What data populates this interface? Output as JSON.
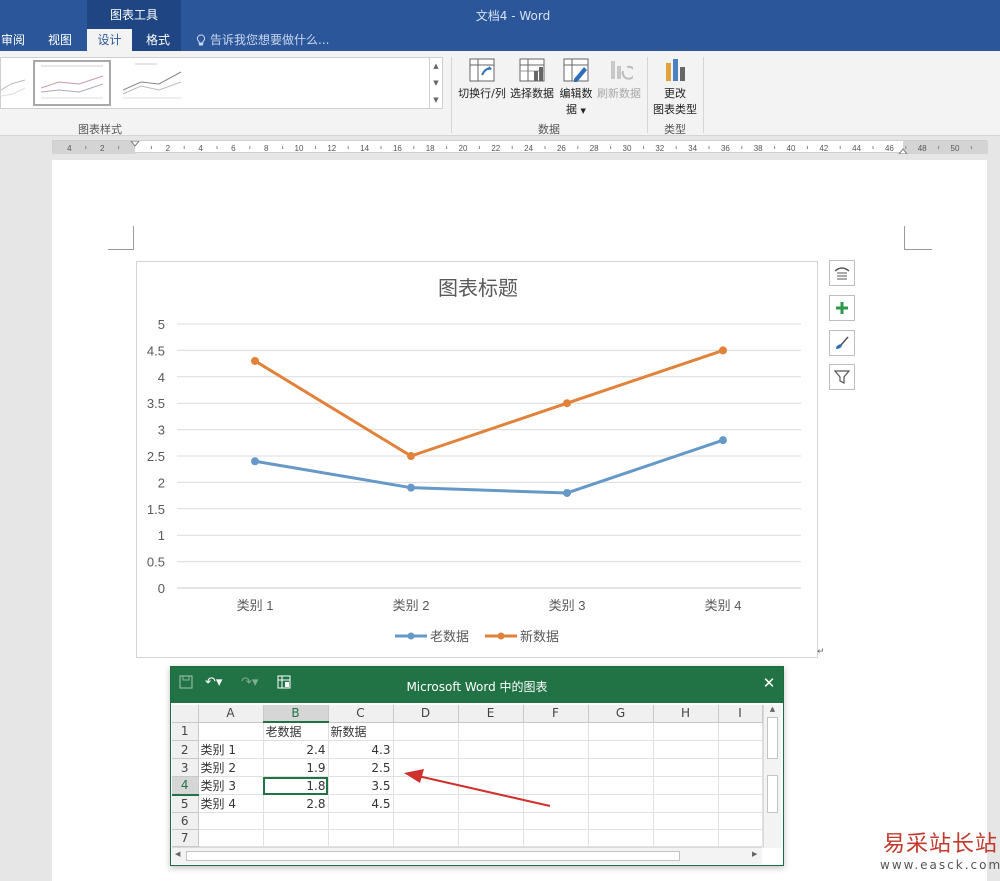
{
  "app": {
    "context_tab_label": "图表工具",
    "document_title": "文档4 - Word"
  },
  "tabs": [
    {
      "label": "审阅",
      "active": false
    },
    {
      "label": "视图",
      "active": false
    },
    {
      "label": "设计",
      "active": true
    },
    {
      "label": "格式",
      "active": false
    }
  ],
  "tell_me": {
    "placeholder": "告诉我您想要做什么..."
  },
  "ribbon": {
    "groups": {
      "chart_styles": "图表样式",
      "data": "数据",
      "type": "类型"
    },
    "buttons": {
      "switch_row_col": "切换行/列",
      "select_data": "选择数据",
      "edit_data_line1": "编辑数",
      "edit_data_line2": "据",
      "refresh_data": "刷新数据",
      "change_type_line1": "更改",
      "change_type_line2": "图表类型"
    }
  },
  "ruler": {
    "labels": [
      "4",
      "2",
      "2",
      "4",
      "6",
      "8",
      "10",
      "12",
      "14",
      "16",
      "18",
      "20",
      "22",
      "24",
      "26",
      "28",
      "30",
      "32",
      "34",
      "36",
      "38",
      "40",
      "42",
      "44",
      "46",
      "48",
      "50"
    ]
  },
  "chart_data": {
    "type": "line",
    "title": "图表标题",
    "categories": [
      "类别 1",
      "类别 2",
      "类别 3",
      "类别 4"
    ],
    "series": [
      {
        "name": "老数据",
        "values": [
          2.4,
          1.9,
          1.8,
          2.8
        ],
        "color": "#6699c7"
      },
      {
        "name": "新数据",
        "values": [
          4.3,
          2.5,
          3.5,
          4.5
        ],
        "color": "#e2823a"
      }
    ],
    "ylim": [
      0,
      5
    ],
    "yticks": [
      "0",
      "0.5",
      "1",
      "1.5",
      "2",
      "2.5",
      "3",
      "3.5",
      "4",
      "4.5",
      "5"
    ],
    "grid": true,
    "legend": "bottom"
  },
  "chart_tools": [
    "layout-options",
    "chart-elements",
    "chart-styles",
    "chart-filters"
  ],
  "excel": {
    "title": "Microsoft Word 中的图表",
    "columns": [
      "A",
      "B",
      "C",
      "D",
      "E",
      "F",
      "G",
      "H",
      "I"
    ],
    "rows": [
      {
        "n": "1",
        "cells": [
          "",
          "老数据",
          "新数据"
        ]
      },
      {
        "n": "2",
        "cells": [
          "类别 1",
          "2.4",
          "4.3"
        ]
      },
      {
        "n": "3",
        "cells": [
          "类别 2",
          "1.9",
          "2.5"
        ]
      },
      {
        "n": "4",
        "cells": [
          "类别 3",
          "1.8",
          "3.5"
        ]
      },
      {
        "n": "5",
        "cells": [
          "类别 4",
          "2.8",
          "4.5"
        ]
      },
      {
        "n": "6",
        "cells": [
          "",
          "",
          ""
        ]
      },
      {
        "n": "7",
        "cells": [
          "",
          "",
          ""
        ]
      }
    ],
    "active_cell": "B4"
  },
  "watermark": {
    "text": "易采站长站",
    "url": "www.easck.com"
  },
  "colors": {
    "word_blue": "#2b579a",
    "excel_green": "#217346",
    "arrow_red": "#d0312d"
  }
}
